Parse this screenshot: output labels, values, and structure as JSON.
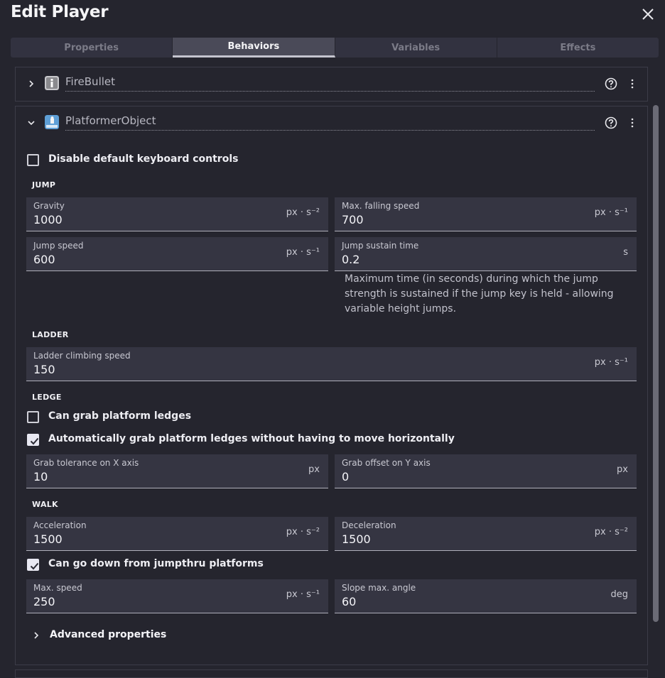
{
  "dialog": {
    "title": "Edit Player",
    "close_icon": "close-icon"
  },
  "tabs": [
    {
      "label": "Properties",
      "active": false
    },
    {
      "label": "Behaviors",
      "active": true
    },
    {
      "label": "Variables",
      "active": false
    },
    {
      "label": "Effects",
      "active": false
    }
  ],
  "behaviors": {
    "firebullet": {
      "name": "FireBullet",
      "expanded": false
    },
    "platformer": {
      "name": "PlatformerObject",
      "expanded": true,
      "disable_keyboard": {
        "label": "Disable default keyboard controls",
        "checked": false
      },
      "sections": {
        "jump": "JUMP",
        "ladder": "LADDER",
        "ledge": "LEDGE",
        "walk": "WALK"
      },
      "fields": {
        "gravity": {
          "label": "Gravity",
          "value": "1000",
          "unit": "px · s⁻²"
        },
        "max_falling_speed": {
          "label": "Max. falling speed",
          "value": "700",
          "unit": "px · s⁻¹"
        },
        "jump_speed": {
          "label": "Jump speed",
          "value": "600",
          "unit": "px · s⁻¹"
        },
        "jump_sustain_time": {
          "label": "Jump sustain time",
          "value": "0.2",
          "unit": "s"
        },
        "ladder_climbing_speed": {
          "label": "Ladder climbing speed",
          "value": "150",
          "unit": "px · s⁻¹"
        },
        "grab_tolerance_x": {
          "label": "Grab tolerance on X axis",
          "value": "10",
          "unit": "px"
        },
        "grab_offset_y": {
          "label": "Grab offset on Y axis",
          "value": "0",
          "unit": "px"
        },
        "acceleration": {
          "label": "Acceleration",
          "value": "1500",
          "unit": "px · s⁻²"
        },
        "deceleration": {
          "label": "Deceleration",
          "value": "1500",
          "unit": "px · s⁻²"
        },
        "max_speed": {
          "label": "Max. speed",
          "value": "250",
          "unit": "px · s⁻¹"
        },
        "slope_max_angle": {
          "label": "Slope max. angle",
          "value": "60",
          "unit": "deg"
        }
      },
      "jump_sustain_help": "Maximum time (in seconds) during which the jump strength is sustained if the jump key is held - allowing variable height jumps.",
      "can_grab_ledges": {
        "label": "Can grab platform ledges",
        "checked": false
      },
      "auto_grab_ledges": {
        "label": "Automatically grab platform ledges without having to move horizontally",
        "checked": true
      },
      "can_go_down_jumpthru": {
        "label": "Can go down from jumpthru platforms",
        "checked": true
      },
      "advanced_label": "Advanced properties"
    }
  },
  "colors": {
    "background": "#25252e",
    "field_bg": "#353542",
    "tab_active": "#4a4a58",
    "text": "#e8e8ec"
  }
}
